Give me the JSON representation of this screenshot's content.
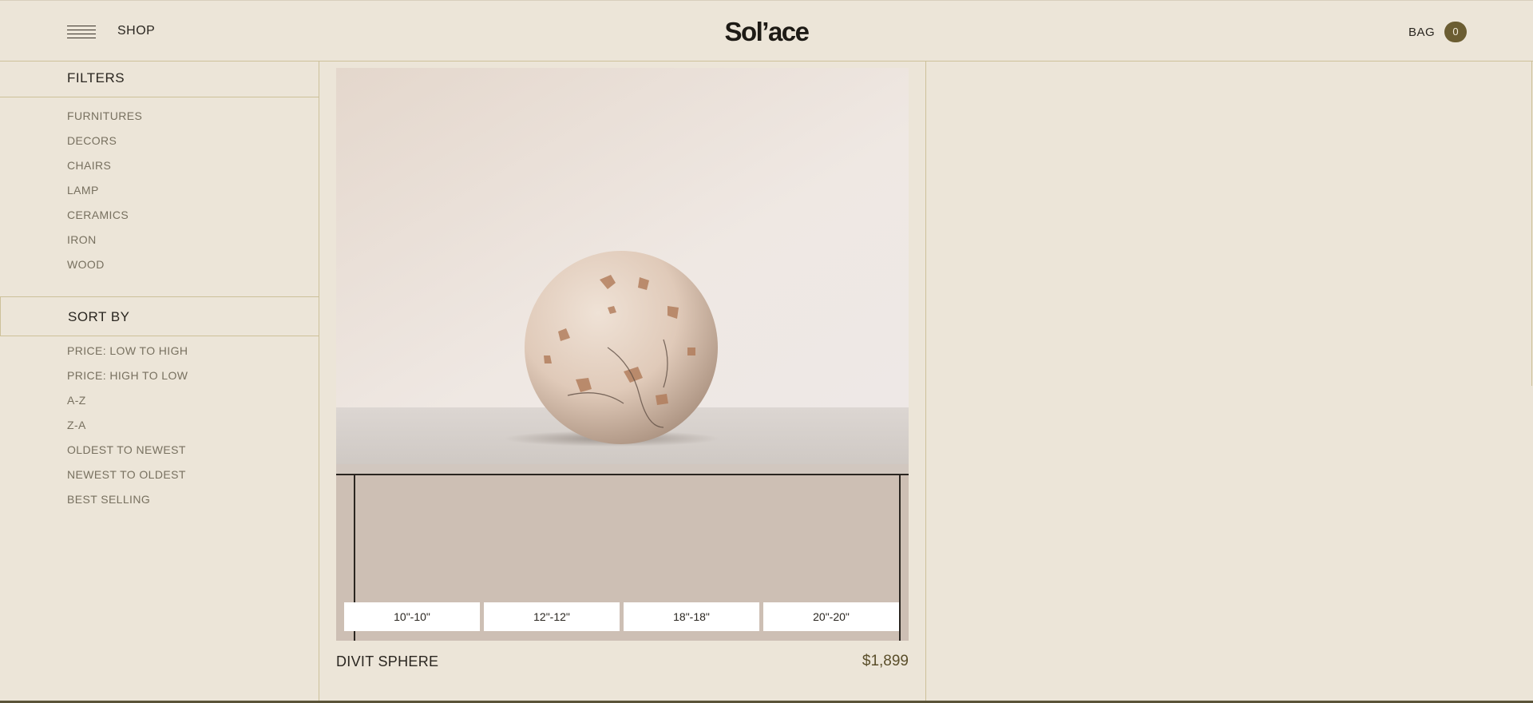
{
  "header": {
    "shop_label": "SHOP",
    "logo": "Sol’ace",
    "bag_label": "BAG",
    "bag_count": "0"
  },
  "filters": {
    "title": "FILTERS",
    "items": [
      {
        "label": "FURNITURES"
      },
      {
        "label": "DECORS"
      },
      {
        "label": "CHAIRS"
      },
      {
        "label": "LAMP"
      },
      {
        "label": "CERAMICS"
      },
      {
        "label": "IRON"
      },
      {
        "label": "WOOD"
      }
    ]
  },
  "sort": {
    "title": "SORT BY",
    "items": [
      {
        "label": "PRICE: LOW TO HIGH"
      },
      {
        "label": "PRICE: HIGH TO LOW"
      },
      {
        "label": "A-Z"
      },
      {
        "label": "Z-A"
      },
      {
        "label": "OLDEST TO NEWEST"
      },
      {
        "label": "NEWEST TO OLDEST"
      },
      {
        "label": "BEST SELLING"
      }
    ]
  },
  "product": {
    "name": "DIVIT SPHERE",
    "price": "$1,899",
    "variants": [
      {
        "label": "10\"-10\""
      },
      {
        "label": "12\"-12\""
      },
      {
        "label": "18\"-18\""
      },
      {
        "label": "20\"-20\""
      }
    ]
  },
  "colors": {
    "background": "#ece5d8",
    "accent": "#6b5d32",
    "border": "#cdc19a",
    "muted_text": "#77705f"
  }
}
